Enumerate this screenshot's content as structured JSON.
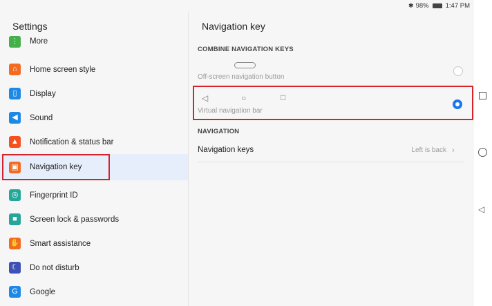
{
  "statusbar": {
    "battery": "98%",
    "time": "1:47 PM"
  },
  "left": {
    "title": "Settings",
    "items": [
      {
        "label": "More",
        "icon": "more-icon",
        "color": "#43b04a"
      },
      {
        "label": "Home screen style",
        "icon": "home-icon",
        "color": "#f36b21"
      },
      {
        "label": "Display",
        "icon": "display-icon",
        "color": "#1e88e5"
      },
      {
        "label": "Sound",
        "icon": "sound-icon",
        "color": "#1e88e5"
      },
      {
        "label": "Notification & status bar",
        "icon": "bell-icon",
        "color": "#f4511e"
      },
      {
        "label": "Navigation key",
        "icon": "navigation-key-icon",
        "color": "#f36b21"
      },
      {
        "label": "Fingerprint ID",
        "icon": "fingerprint-icon",
        "color": "#26a69a"
      },
      {
        "label": "Screen lock & passwords",
        "icon": "lock-icon",
        "color": "#26a69a"
      },
      {
        "label": "Smart assistance",
        "icon": "hand-icon",
        "color": "#f36b21"
      },
      {
        "label": "Do not disturb",
        "icon": "moon-icon",
        "color": "#3f51b5"
      },
      {
        "label": "Google",
        "icon": "google-icon",
        "color": "#1e88e5"
      }
    ]
  },
  "right": {
    "title": "Navigation key",
    "section1": "COMBINE NAVIGATION KEYS",
    "option1": "Off-screen navigation button",
    "option2": "Virtual navigation bar",
    "section2": "NAVIGATION",
    "nav_keys_label": "Navigation keys",
    "nav_keys_value": "Left is back",
    "selected_option": "Virtual navigation bar"
  },
  "colors": {
    "accent": "#1976f2",
    "highlight_box": "#d6232a",
    "selected_row": "#e6eefb"
  }
}
